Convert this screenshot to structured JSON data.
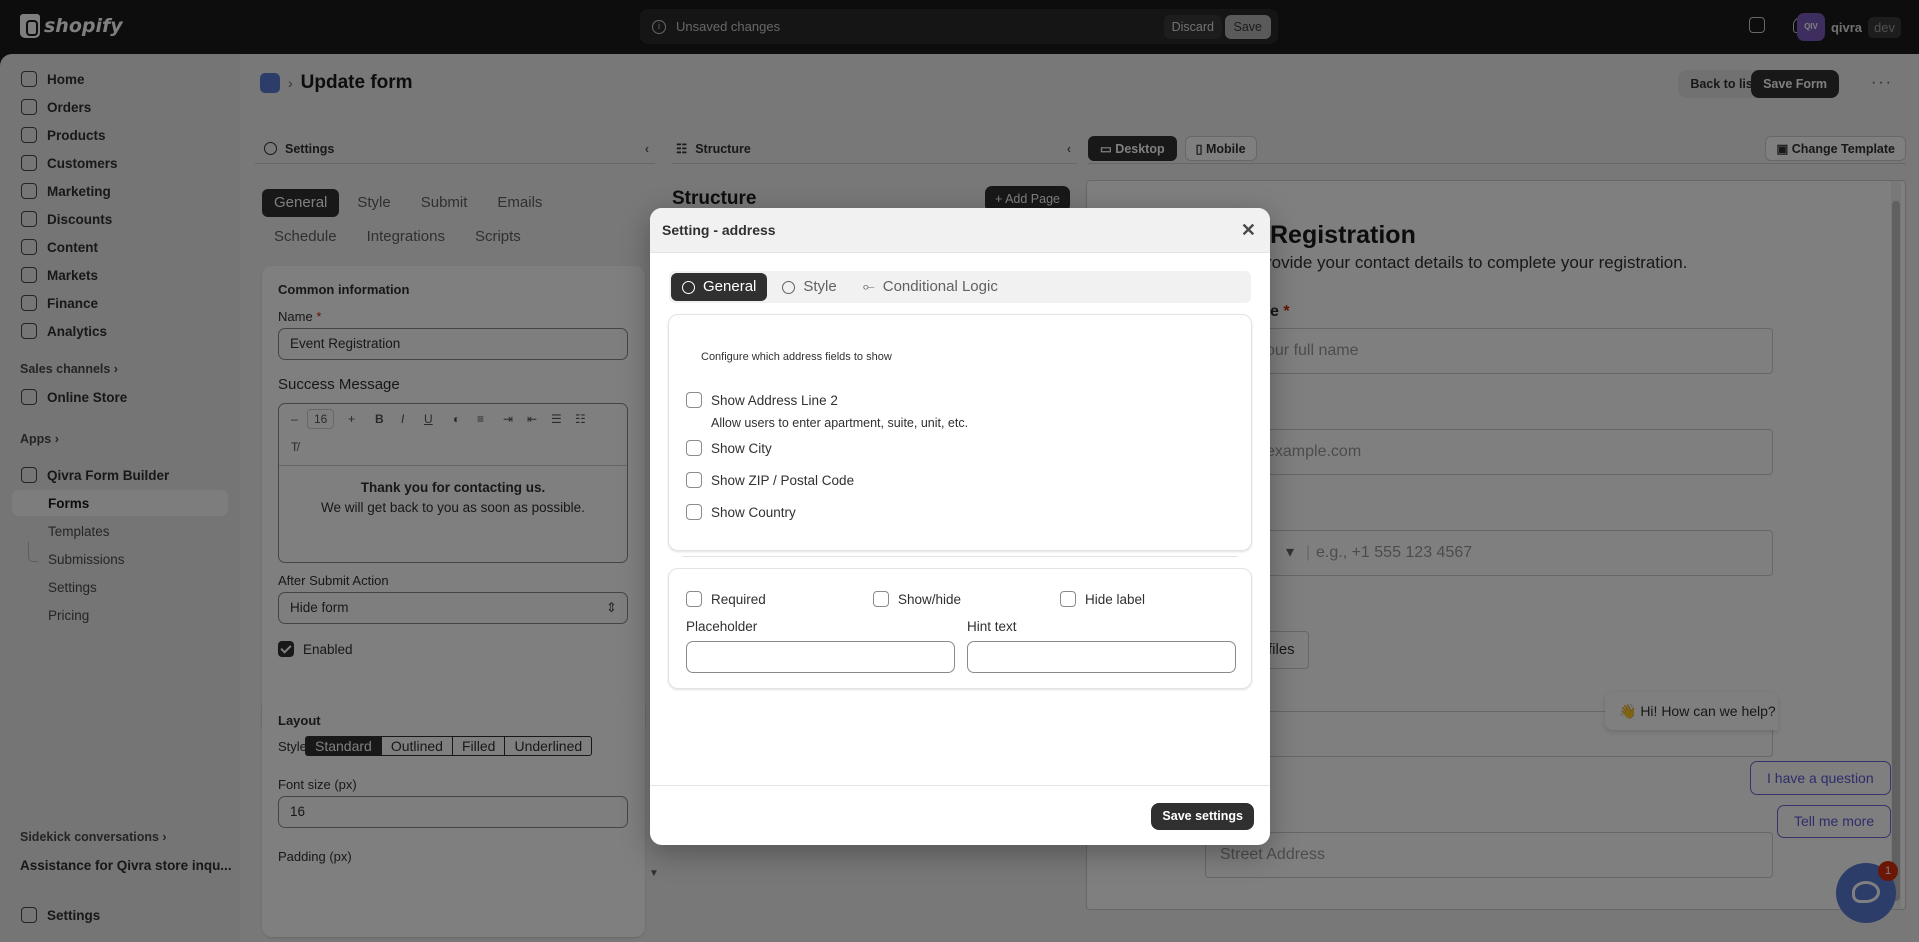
{
  "topbar": {
    "brand": "shopify",
    "unsaved_text": "Unsaved changes",
    "discard_label": "Discard",
    "save_label": "Save",
    "store_name": "qivra",
    "store_tag": "dev",
    "avatar_text": "QIV"
  },
  "sidebar": {
    "items": [
      {
        "label": "Home"
      },
      {
        "label": "Orders"
      },
      {
        "label": "Products"
      },
      {
        "label": "Customers"
      },
      {
        "label": "Marketing"
      },
      {
        "label": "Discounts"
      },
      {
        "label": "Content"
      },
      {
        "label": "Markets"
      },
      {
        "label": "Finance"
      },
      {
        "label": "Analytics"
      }
    ],
    "sales_channels": "Sales channels",
    "online_store": "Online Store",
    "apps": "Apps",
    "app_name": "Qivra Form Builder",
    "app_sub": [
      "Forms",
      "Templates",
      "Submissions",
      "Settings",
      "Pricing"
    ],
    "sidekick": "Sidekick conversations",
    "assistance": "Assistance for Qivra store inqu...",
    "settings": "Settings"
  },
  "page": {
    "title": "Update form",
    "back_label": "Back to list",
    "save_form_label": "Save Form",
    "more": "···"
  },
  "settings_panel": {
    "header": "Settings",
    "tabs": [
      "General",
      "Style",
      "Submit",
      "Emails",
      "Schedule",
      "Integrations",
      "Scripts"
    ],
    "common_info": "Common information",
    "name_label": "Name",
    "name_value": "Event Registration",
    "success_label": "Success Message",
    "font_size": "16",
    "msg_line1": "Thank you for contacting us.",
    "msg_line2": "We will get back to you as soon as possible.",
    "after_submit_label": "After Submit Action",
    "after_submit_value": "Hide form",
    "enabled_label": "Enabled",
    "layout_label": "Layout",
    "style_label": "Style:",
    "style_options": [
      "Standard",
      "Outlined",
      "Filled",
      "Underlined"
    ],
    "font_size_label": "Font size (px)",
    "font_size_value": "16",
    "padding_label": "Padding (px)"
  },
  "structure_panel": {
    "header": "Structure",
    "title": "Structure",
    "add_page": "Add Page"
  },
  "preview": {
    "desktop": "Desktop",
    "mobile": "Mobile",
    "change_template": "Change Template",
    "form_title": "Registration",
    "form_subtitle": "rovide your contact details to complete your registration.",
    "name_partial": "e",
    "name_placeholder": "our full name",
    "email_placeholder": "example.com",
    "phone_placeholder": "e.g., +1 555 123 4567",
    "files": "files",
    "street_placeholder": "Street Address",
    "chat_greeting": "👋 Hi! How can we help?",
    "chat_q1": "I have a question",
    "chat_q2": "Tell me more",
    "chat_badge": "1"
  },
  "modal": {
    "title": "Setting - address",
    "tabs": [
      "General",
      "Style",
      "Conditional Logic"
    ],
    "configure_text": "Configure which address fields to show",
    "options": [
      {
        "label": "Show Address Line 2",
        "hint": "Allow users to enter apartment, suite, unit, etc."
      },
      {
        "label": "Show City"
      },
      {
        "label": "Show ZIP / Postal Code"
      },
      {
        "label": "Show Country"
      }
    ],
    "required": "Required",
    "showhide": "Show/hide",
    "hide_label": "Hide label",
    "placeholder_label": "Placeholder",
    "hint_label": "Hint text",
    "save_settings": "Save settings"
  }
}
